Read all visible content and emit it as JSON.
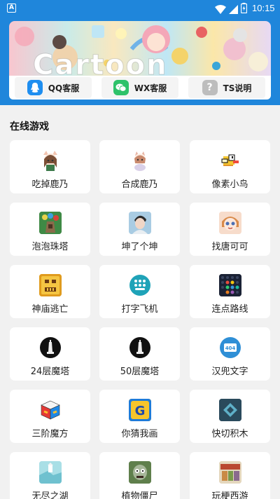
{
  "status_bar": {
    "app_badge": "A",
    "time": "10:15"
  },
  "banner": {
    "title": "Cartoon"
  },
  "quick_buttons": [
    {
      "label": "QQ客服",
      "icon": "qq-icon"
    },
    {
      "label": "WX客服",
      "icon": "wechat-icon"
    },
    {
      "label": "TS说明",
      "icon": "question-icon"
    }
  ],
  "section": {
    "title": "在线游戏"
  },
  "games": [
    {
      "label": "吃掉鹿乃",
      "icon": "anime-girl-icon"
    },
    {
      "label": "合成鹿乃",
      "icon": "chibi-girl-icon"
    },
    {
      "label": "像素小鸟",
      "icon": "pixel-bird-icon"
    },
    {
      "label": "泡泡珠塔",
      "icon": "bubble-tower-icon"
    },
    {
      "label": "坤了个坤",
      "icon": "portrait-icon"
    },
    {
      "label": "找唐可可",
      "icon": "cartoon-face-icon"
    },
    {
      "label": "神庙逃亡",
      "icon": "temple-run-icon"
    },
    {
      "label": "打字飞机",
      "icon": "keypad-icon"
    },
    {
      "label": "连点路线",
      "icon": "dot-grid-icon"
    },
    {
      "label": "24层魔塔",
      "icon": "tower-icon"
    },
    {
      "label": "50层魔塔",
      "icon": "tower-icon"
    },
    {
      "label": "汉兜文字",
      "icon": "404-icon"
    },
    {
      "label": "三阶魔方",
      "icon": "rubiks-cube-icon"
    },
    {
      "label": "你猜我画",
      "icon": "g-letter-icon"
    },
    {
      "label": "快切积木",
      "icon": "block-icon"
    },
    {
      "label": "无尽之湖",
      "icon": "lake-icon"
    },
    {
      "label": "植物僵尸",
      "icon": "zombie-icon"
    },
    {
      "label": "玩梗西游",
      "icon": "journey-west-icon"
    }
  ],
  "colors": {
    "header_blue": "#1f86db",
    "qq_blue": "#1e8ef0",
    "wechat_green": "#2ec26a"
  }
}
